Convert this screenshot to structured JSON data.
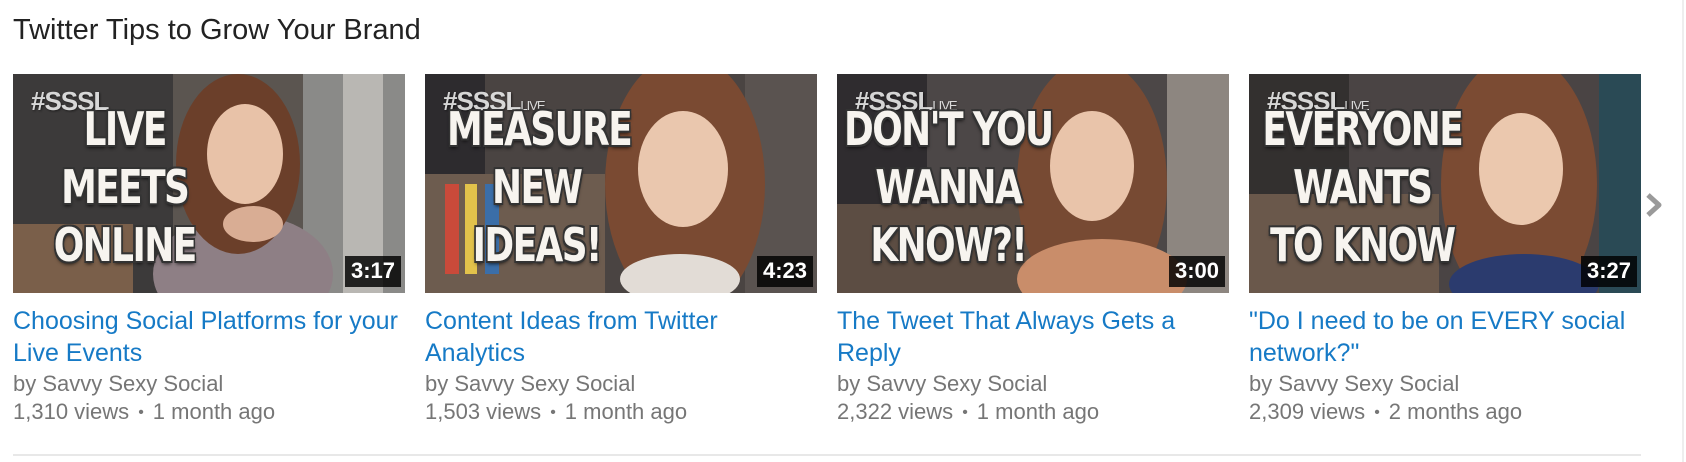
{
  "shelf": {
    "title": "Twitter Tips to Grow Your Brand"
  },
  "videos": [
    {
      "title": "Choosing Social Platforms for your Live Events",
      "byline": "by Savvy Sexy Social",
      "views": "1,310 views",
      "age": "1 month ago",
      "duration": "3:17",
      "thumb_text": [
        "LIVE",
        "MEETS",
        "ONLINE"
      ],
      "thumb_hashtag": "#SSSL"
    },
    {
      "title": "Content Ideas from Twitter Analytics",
      "byline": "by Savvy Sexy Social",
      "views": "1,503 views",
      "age": "1 month ago",
      "duration": "4:23",
      "thumb_text": [
        "MEASURE",
        "NEW",
        "IDEAS!"
      ],
      "thumb_hashtag": "#SSSL"
    },
    {
      "title": "The Tweet That Always Gets a Reply",
      "byline": "by Savvy Sexy Social",
      "views": "2,322 views",
      "age": "1 month ago",
      "duration": "3:00",
      "thumb_text": [
        "DON'T YOU",
        "WANNA",
        "KNOW?!"
      ],
      "thumb_hashtag": "#SSSL"
    },
    {
      "title": "\"Do I need to be on EVERY social network?\"",
      "byline": "by Savvy Sexy Social",
      "views": "2,309 views",
      "age": "2 months ago",
      "duration": "3:27",
      "thumb_text": [
        "EVERYONE",
        "WANTS",
        "TO KNOW"
      ],
      "thumb_hashtag": "#SSSL"
    }
  ],
  "colors": {
    "link": "#167ac6",
    "meta": "#767676",
    "title": "#222222"
  },
  "icons": {
    "next": "chevron-right-icon"
  }
}
